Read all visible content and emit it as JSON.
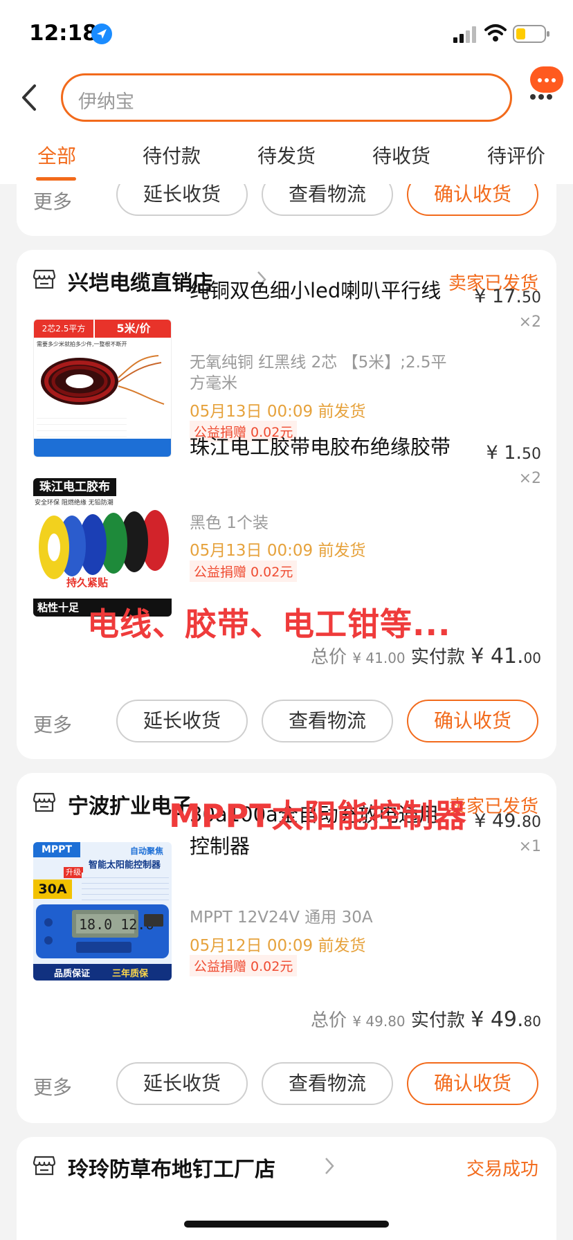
{
  "status_bar": {
    "time": "12:18"
  },
  "search": {
    "placeholder": "伊纳宝"
  },
  "tabs": [
    {
      "label": "全部"
    },
    {
      "label": "待付款"
    },
    {
      "label": "待发货"
    },
    {
      "label": "待收货"
    },
    {
      "label": "待评价"
    }
  ],
  "actions": {
    "more": "更多",
    "extend": "延长收货",
    "logistics": "查看物流",
    "confirm": "确认收货"
  },
  "orders": [
    {
      "store": "兴垲电缆直销店",
      "status": "卖家已发货",
      "items": [
        {
          "title": "纯铜双色细小led喇叭平行线",
          "price_int": "¥ 17.",
          "price_dec": "50",
          "qty": "×2",
          "sku": "无氧纯铜 红黑线 2芯 【5米】;2.5平方毫米",
          "ship": "05月13日 00:09 前发货",
          "donate": "公益捐赠 0.02元",
          "thumb_top_left": "2芯2.5平方",
          "thumb_top_right": "5米/价",
          "thumb_note": "需要多少米就拍多少件,一整根不断开"
        },
        {
          "title": "珠江电工胶带电胶布绝缘胶带",
          "price_int": "¥ 1.",
          "price_dec": "50",
          "qty": "×2",
          "sku": "黑色 1个装",
          "ship": "05月13日 00:09 前发货",
          "donate": "公益捐赠 0.02元",
          "thumb_top": "珠江电工胶布",
          "thumb_sub": "安全环保 阻燃绝缘 无铅防潮",
          "thumb_mid": "持久紧贴",
          "thumb_bottom": "粘性十足"
        }
      ],
      "totals": {
        "total_label": "总价",
        "total_int": "¥ 41.",
        "total_dec": "00",
        "paid_label": "实付款",
        "paid_int": "¥ 41.",
        "paid_dec": "00"
      }
    },
    {
      "store": "宁波扩业电子",
      "status": "卖家已发货",
      "items": [
        {
          "title": "30a100a全自动充放电通用控制器",
          "price_int": "¥ 49.",
          "price_dec": "80",
          "qty": "×1",
          "sku": "MPPT 12V24V 通用 30A",
          "ship": "05月12日 00:09 前发货",
          "donate": "公益捐赠 0.02元",
          "thumb_badge": "MPPT",
          "thumb_tag": "自动聚焦",
          "thumb_title": "智能太阳能控制器",
          "thumb_amp": "30A",
          "thumb_upgrade": "升级",
          "thumb_bottom_left": "品质保证",
          "thumb_bottom_right": "三年质保"
        }
      ],
      "totals": {
        "total_label": "总价",
        "total_int": "¥ 49.",
        "total_dec": "80",
        "paid_label": "实付款",
        "paid_int": "¥ 49.",
        "paid_dec": "80"
      }
    },
    {
      "store": "玲玲防草布地钉工厂店",
      "status": "交易成功"
    }
  ],
  "overlays": {
    "first": "电线、胶带、电工钳等...",
    "second": "MPPT太阳能控制器"
  },
  "colors": {
    "accent": "#f26a1b",
    "overlay_red": "#ef3b3b",
    "ship_amber": "#e6a23c"
  }
}
